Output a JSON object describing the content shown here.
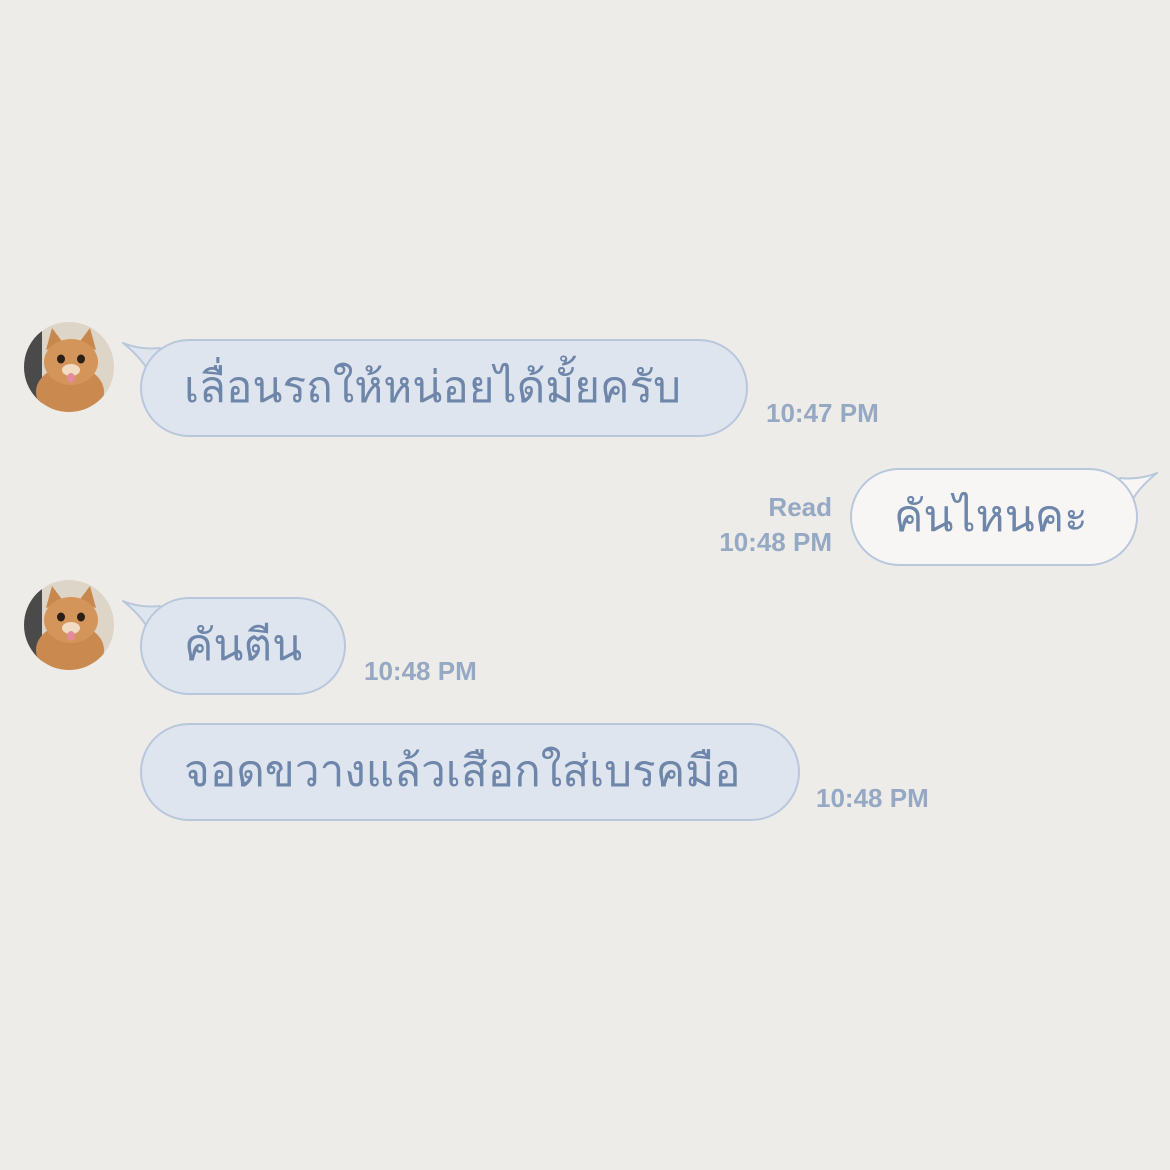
{
  "colors": {
    "background": "#eeece9",
    "incoming_bubble": "#dfe5ee",
    "outgoing_bubble": "#f7f6f4",
    "bubble_border": "#b9c7dc",
    "text": "#6e86aa",
    "meta_text": "#95a8c4"
  },
  "messages": [
    {
      "direction": "incoming",
      "avatar_icon": "cat-avatar-icon",
      "text": "เลื่อนรถให้หน่อยได้มั้ยครับ",
      "time": "10:47 PM"
    },
    {
      "direction": "outgoing",
      "read_label": "Read",
      "text": "คันไหนคะ",
      "time": "10:48 PM"
    },
    {
      "direction": "incoming",
      "avatar_icon": "cat-avatar-icon",
      "text": "คันตีน",
      "time": "10:48 PM"
    },
    {
      "direction": "incoming",
      "text": "จอดขวางแล้วเสือกใส่เบรคมือ",
      "time": "10:48 PM"
    }
  ]
}
